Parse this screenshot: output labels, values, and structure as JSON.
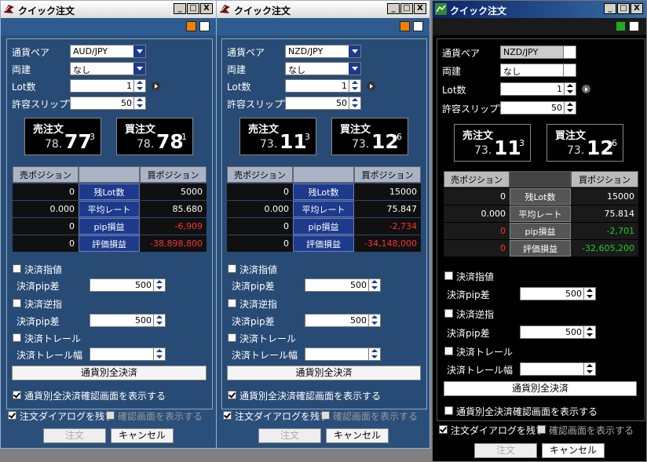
{
  "windows": [
    {
      "id": "win1",
      "title": "クイック注文",
      "labels": {
        "pair": "通貨ペア",
        "both": "両建",
        "lot": "Lot数",
        "slip": "許容スリップ゜"
      },
      "pair_value": "AUD/JPY",
      "both_value": "なし",
      "lot_value": "1",
      "slip_value": "50",
      "sell": {
        "label": "売注文",
        "small": "78.",
        "big": "77",
        "tail": "3"
      },
      "buy": {
        "label": "買注文",
        "small": "78.",
        "big": "78",
        "tail": "1"
      },
      "table": {
        "head_sell": "売ポジション",
        "head_buy": "買ポジション",
        "rows": [
          {
            "sell": "0",
            "label": "残Lot数",
            "buy": "5000"
          },
          {
            "sell": "0.000",
            "label": "平均レート",
            "buy": "85.680"
          },
          {
            "sell": "0",
            "label": "pip損益",
            "buy": "-6,909"
          },
          {
            "sell": "0",
            "label": "評価損益",
            "buy": "-38,898,800"
          }
        ]
      },
      "settle": {
        "limit_label": "決済指値",
        "limit_pip_label": "決済pip差",
        "limit_pip_value": "500",
        "stop_label": "決済逆指",
        "stop_pip_label": "決済pip差",
        "stop_pip_value": "500",
        "trail_label": "決済トレール",
        "trail_width_label": "決済トレール幅",
        "trail_width_value": ""
      },
      "all_settle_button": "通貨別全決済",
      "confirm_all_label": "通貨別全決済確認画面を表示する",
      "keep_dialog_label": "注文ダイアログを残す",
      "show_confirm_label": "確認画面を表示する",
      "order_button": "注文",
      "cancel_button": "キャンセル"
    },
    {
      "id": "win2",
      "title": "クイック注文",
      "labels": {
        "pair": "通貨ペア",
        "both": "両建",
        "lot": "Lot数",
        "slip": "許容スリップ゜"
      },
      "pair_value": "NZD/JPY",
      "both_value": "なし",
      "lot_value": "1",
      "slip_value": "50",
      "sell": {
        "label": "売注文",
        "small": "73.",
        "big": "11",
        "tail": "3"
      },
      "buy": {
        "label": "買注文",
        "small": "73.",
        "big": "12",
        "tail": "6"
      },
      "table": {
        "head_sell": "売ポジション",
        "head_buy": "買ポジション",
        "rows": [
          {
            "sell": "0",
            "label": "残Lot数",
            "buy": "15000"
          },
          {
            "sell": "0.000",
            "label": "平均レート",
            "buy": "75.847"
          },
          {
            "sell": "0",
            "label": "pip損益",
            "buy": "-2,734"
          },
          {
            "sell": "0",
            "label": "評価損益",
            "buy": "-34,148,000"
          }
        ]
      },
      "settle": {
        "limit_label": "決済指値",
        "limit_pip_label": "決済pip差",
        "limit_pip_value": "500",
        "stop_label": "決済逆指",
        "stop_pip_label": "決済pip差",
        "stop_pip_value": "500",
        "trail_label": "決済トレール",
        "trail_width_label": "決済トレール幅",
        "trail_width_value": ""
      },
      "all_settle_button": "通貨別全決済",
      "confirm_all_label": "通貨別全決済確認画面を表示する",
      "keep_dialog_label": "注文ダイアログを残す",
      "show_confirm_label": "確認画面を表示する",
      "order_button": "注文",
      "cancel_button": "キャンセル"
    },
    {
      "id": "win3",
      "title": "クイック注文",
      "labels": {
        "pair": "通貨ペア",
        "both": "両建",
        "lot": "Lot数",
        "slip": "許容スリップ゜"
      },
      "pair_value": "NZD/JPY",
      "both_value": "なし",
      "lot_value": "1",
      "slip_value": "50",
      "sell": {
        "label": "売注文",
        "small": "73.",
        "big": "11",
        "tail": "3"
      },
      "buy": {
        "label": "買注文",
        "small": "73.",
        "big": "12",
        "tail": "6"
      },
      "table": {
        "head_sell": "売ポジション",
        "head_buy": "買ポジション",
        "rows": [
          {
            "sell": "0",
            "label": "残Lot数",
            "buy": "15000"
          },
          {
            "sell": "0.000",
            "label": "平均レート",
            "buy": "75.814"
          },
          {
            "sell": "0",
            "label": "pip損益",
            "buy": "-2,701"
          },
          {
            "sell": "0",
            "label": "評価損益",
            "buy": "-32,605,200"
          }
        ]
      },
      "settle": {
        "limit_label": "決済指値",
        "limit_pip_label": "決済pip差",
        "limit_pip_value": "500",
        "stop_label": "決済逆指",
        "stop_pip_label": "決済pip差",
        "stop_pip_value": "500",
        "trail_label": "決済トレール",
        "trail_width_label": "決済トレール幅",
        "trail_width_value": ""
      },
      "all_settle_button": "通貨別全決済",
      "confirm_all_label": "通貨別全決済確認画面を表示する",
      "keep_dialog_label": "注文ダイアログを残す",
      "show_confirm_label": "確認画面を表示する",
      "order_button": "注文",
      "cancel_button": "キャンセル"
    }
  ],
  "window_controls": {
    "minimize": "_",
    "maximize": "□",
    "close": "X"
  },
  "colors": {
    "classic_bg": "#1f4e79",
    "classic_title": "#ffffff",
    "dark_bg": "#000000",
    "dark_title": "#0a246a",
    "negative": "#ff3030",
    "positive": "#22cc22",
    "header_cell": "#1d3a8c"
  }
}
